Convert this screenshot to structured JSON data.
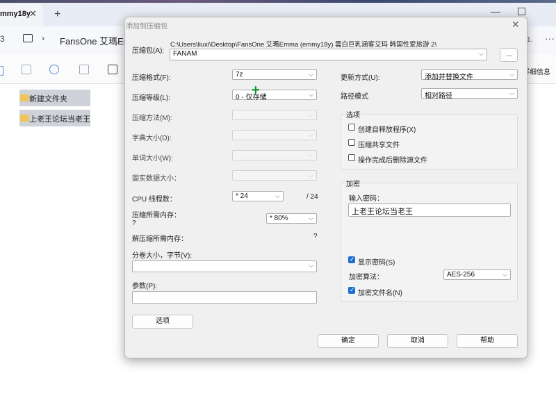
{
  "explorer": {
    "tab_label": "mmy18y",
    "tab_close": "✕",
    "tab_add": "+",
    "win_min": "—",
    "addr_left": "3",
    "address": "FansOne 艾瑪Em",
    "addr_right": "1.",
    "addr_more": "···",
    "details": "详细信息",
    "files": [
      {
        "label": "新建文件夹"
      },
      {
        "label": "上老王论坛当老王"
      }
    ]
  },
  "dialog": {
    "title": "添加到压缩包",
    "close": "✕",
    "archive_label": "压缩包(A):",
    "archive_path": "C:\\Users\\liuxi\\Desktop\\FansOne 艾瑪Emma (emmy18y) 雲白巨乳涵客艾玛 韩国性爱旅游 2\\",
    "archive_name": "FANAM",
    "browse_label": "...",
    "left": {
      "format_label": "压缩格式(F):",
      "format_value": "7z",
      "level_label": "压缩等级(L):",
      "level_value": "0 - 仅存储",
      "method_label": "压缩方法(M):",
      "dict_label": "字典大小(D):",
      "word_label": "单词大小(W):",
      "solid_label": "固实数据大小：",
      "cpu_label": "CPU 线程数：",
      "cpu_value": "* 24",
      "cpu_total": "/ 24",
      "mem_label": "压缩所需内存：",
      "mem_q": "?",
      "mem_value": "* 80%",
      "dmem_label": "解压缩所需内存：",
      "dmem_q": "?",
      "volume_label": "分卷大小，字节(V):",
      "params_label": "参数(P):",
      "options_button": "选项"
    },
    "right": {
      "update_label": "更新方式(U):",
      "update_value": "添加并替换文件",
      "path_label": "路径模式",
      "path_value": "相对路径",
      "options_title": "选项",
      "opt_sfx": "创建自释放程序(X)",
      "opt_shared": "压缩共享文件",
      "opt_delete": "操作完成后删除源文件",
      "enc_title": "加密",
      "pwd_label": "输入密码：",
      "pwd_value": "上老王论坛当老王",
      "show_pwd": "显示密码(S)",
      "algo_label": "加密算法：",
      "algo_value": "AES-256",
      "enc_names": "加密文件名(N)"
    },
    "ok_button": "确定",
    "cancel_button": "取消",
    "help_button": "帮助"
  }
}
